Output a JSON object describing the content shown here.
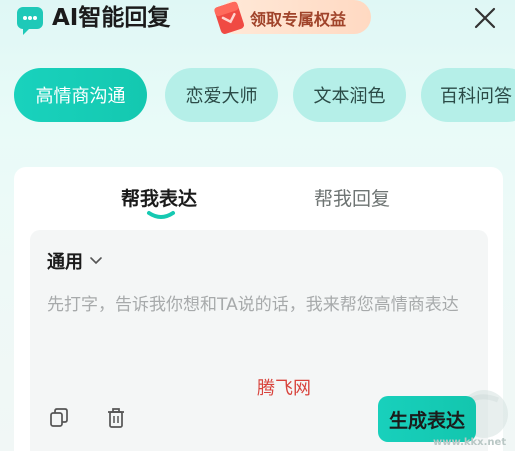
{
  "header": {
    "title": "AI智能回复",
    "promo_label": "领取专属权益",
    "close_icon": "close-icon"
  },
  "categories": [
    {
      "label": "高情商沟通",
      "active": true
    },
    {
      "label": "恋爱大师",
      "active": false
    },
    {
      "label": "文本润色",
      "active": false
    },
    {
      "label": "百科问答",
      "active": false
    }
  ],
  "tabs": [
    {
      "label": "帮我表达",
      "active": true
    },
    {
      "label": "帮我回复",
      "active": false
    }
  ],
  "editor": {
    "mode": "通用",
    "placeholder": "先打字，告诉我你想和TA说的话，我来帮您高情商表达"
  },
  "actions": {
    "generate_label": "生成表达"
  },
  "watermark": {
    "text": "腾飞网",
    "url": "www.kkx.net"
  },
  "colors": {
    "accent": "#19d2bd",
    "chip_bg": "#b5efe8",
    "watermark": "#d8433c"
  }
}
